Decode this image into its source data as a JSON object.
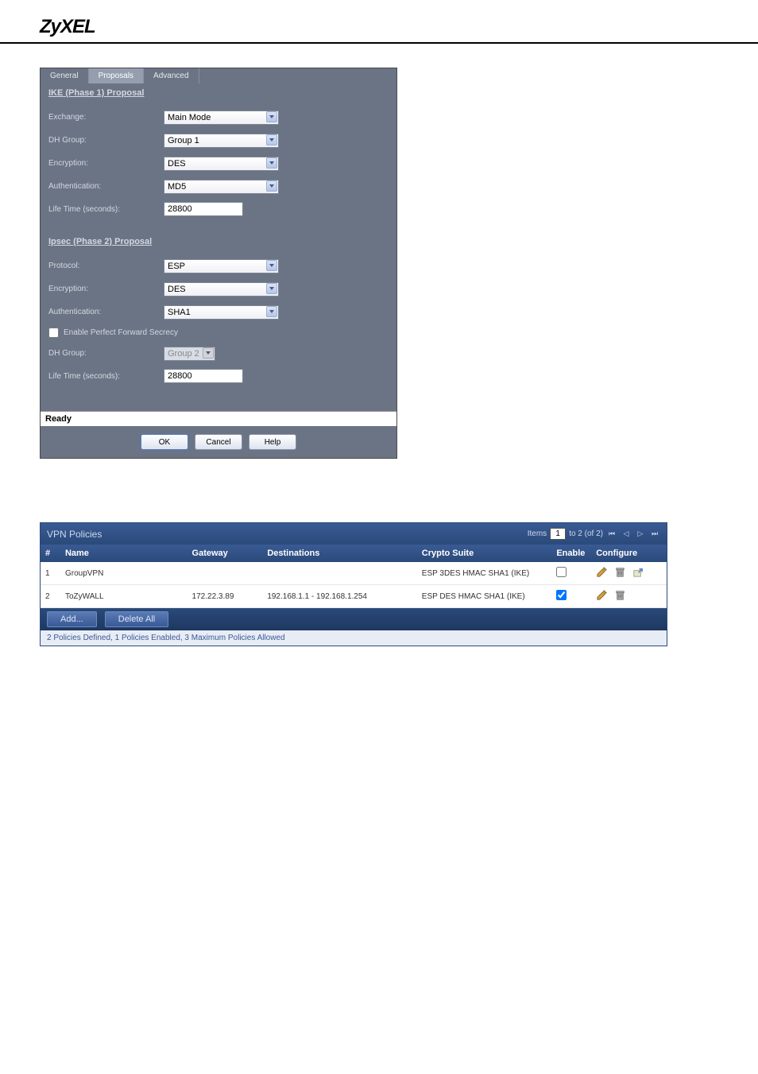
{
  "logo": "ZyXEL",
  "dialog": {
    "tabs": {
      "general": "General",
      "proposals": "Proposals",
      "advanced": "Advanced"
    },
    "phase1_header": "IKE (Phase 1) Proposal",
    "phase1": {
      "exchange_label": "Exchange:",
      "exchange_value": "Main Mode",
      "dhgroup_label": "DH Group:",
      "dhgroup_value": "Group 1",
      "encryption_label": "Encryption:",
      "encryption_value": "DES",
      "auth_label": "Authentication:",
      "auth_value": "MD5",
      "lifetime_label": "Life Time (seconds):",
      "lifetime_value": "28800"
    },
    "phase2_header": "Ipsec (Phase 2) Proposal",
    "phase2": {
      "protocol_label": "Protocol:",
      "protocol_value": "ESP",
      "encryption_label": "Encryption:",
      "encryption_value": "DES",
      "auth_label": "Authentication:",
      "auth_value": "SHA1",
      "pfs_label": "Enable Perfect Forward Secrecy",
      "dhgroup_label": "DH Group:",
      "dhgroup_value": "Group 2",
      "lifetime_label": "Life Time (seconds):",
      "lifetime_value": "28800"
    },
    "status": "Ready",
    "buttons": {
      "ok": "OK",
      "cancel": "Cancel",
      "help": "Help"
    }
  },
  "vpn": {
    "title": "VPN Policies",
    "pager": {
      "items_label": "Items",
      "items_value": "1",
      "range": "to 2 (of 2)"
    },
    "headers": {
      "num": "#",
      "name": "Name",
      "gateway": "Gateway",
      "destinations": "Destinations",
      "crypto": "Crypto Suite",
      "enable": "Enable",
      "configure": "Configure"
    },
    "rows": [
      {
        "num": "1",
        "name": "GroupVPN",
        "gateway": "",
        "destinations": "",
        "crypto": "ESP 3DES HMAC SHA1 (IKE)",
        "enabled": false,
        "show_export": true
      },
      {
        "num": "2",
        "name": "ToZyWALL",
        "gateway": "172.22.3.89",
        "destinations": "192.168.1.1 - 192.168.1.254",
        "crypto": "ESP DES HMAC SHA1 (IKE)",
        "enabled": true,
        "show_export": false
      }
    ],
    "actions": {
      "add": "Add...",
      "delete_all": "Delete All"
    },
    "status": "2 Policies Defined, 1 Policies Enabled, 3 Maximum Policies Allowed"
  }
}
